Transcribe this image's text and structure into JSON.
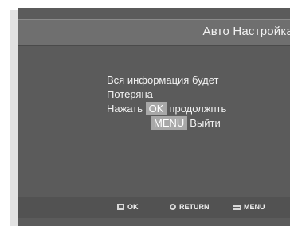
{
  "header": {
    "title": "Авто Настройка"
  },
  "message": {
    "line1": "Вся информация будет",
    "line2": "Потеряна",
    "line3_prefix": "Нажать",
    "ok_key": "OK",
    "line3_suffix": "продолжпть",
    "menu_key": "MENU",
    "line4_suffix": "Выйти"
  },
  "footer": {
    "ok_label": "OK",
    "return_label": "RETURN",
    "menu_label": "MENU"
  },
  "icons": {
    "ok": "enter-icon",
    "return": "return-icon",
    "menu": "menu-icon"
  },
  "colors": {
    "panel": "#5b5b5b",
    "titlebar": "#6f6f6f",
    "highlight": "#a8a8a8",
    "text": "#f2f2f2"
  }
}
